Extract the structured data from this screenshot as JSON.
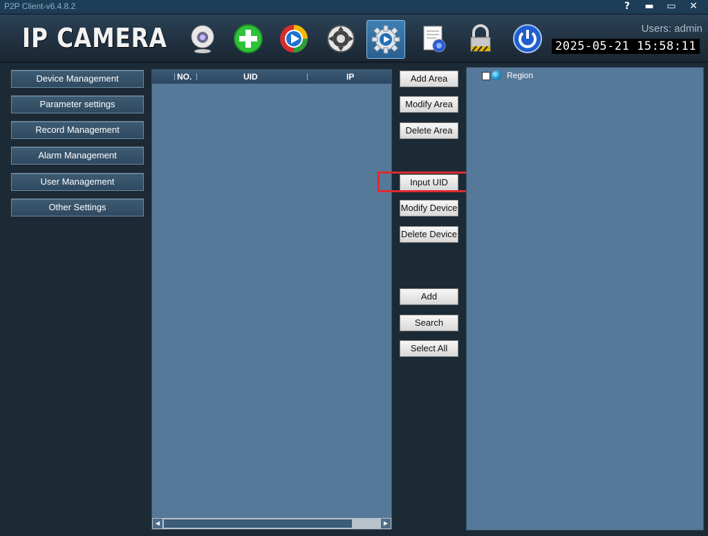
{
  "window": {
    "title": "P2P Client-v6.4.8.2",
    "controls": {
      "help": "?",
      "minimize": "▬",
      "maximize": "▭",
      "close": "✕"
    }
  },
  "header": {
    "logo": "IP CAMERA",
    "toolbar": [
      {
        "icon": "webcam-icon"
      },
      {
        "icon": "add-device-icon"
      },
      {
        "icon": "playback-icon"
      },
      {
        "icon": "ptz-control-icon"
      },
      {
        "icon": "settings-icon",
        "active": true
      },
      {
        "icon": "log-document-icon"
      },
      {
        "icon": "lock-icon"
      },
      {
        "icon": "power-icon"
      }
    ],
    "users_label": "Users: admin",
    "datetime": "2025-05-21  15:58:11"
  },
  "sidebar": {
    "items": [
      {
        "label": "Device Management"
      },
      {
        "label": "Parameter settings"
      },
      {
        "label": "Record Management"
      },
      {
        "label": "Alarm Management"
      },
      {
        "label": "User Management"
      },
      {
        "label": "Other Settings"
      }
    ]
  },
  "device_list": {
    "columns": [
      "NO.",
      "UID",
      "IP"
    ],
    "rows": []
  },
  "actions": {
    "add_area": "Add Area",
    "modify_area": "Modify Area",
    "delete_area": "Delete Area",
    "input_uid": "Input UID",
    "modify_device": "Modify Device",
    "delete_device": "Delete Device",
    "add": "Add",
    "search": "Search",
    "select_all": "Select All"
  },
  "tree": {
    "root": {
      "label": "Region",
      "checked": false,
      "icon": "globe-icon"
    }
  },
  "colors": {
    "panel": "#56799a",
    "background": "#1c2a35",
    "highlight": "#e02a2f"
  }
}
